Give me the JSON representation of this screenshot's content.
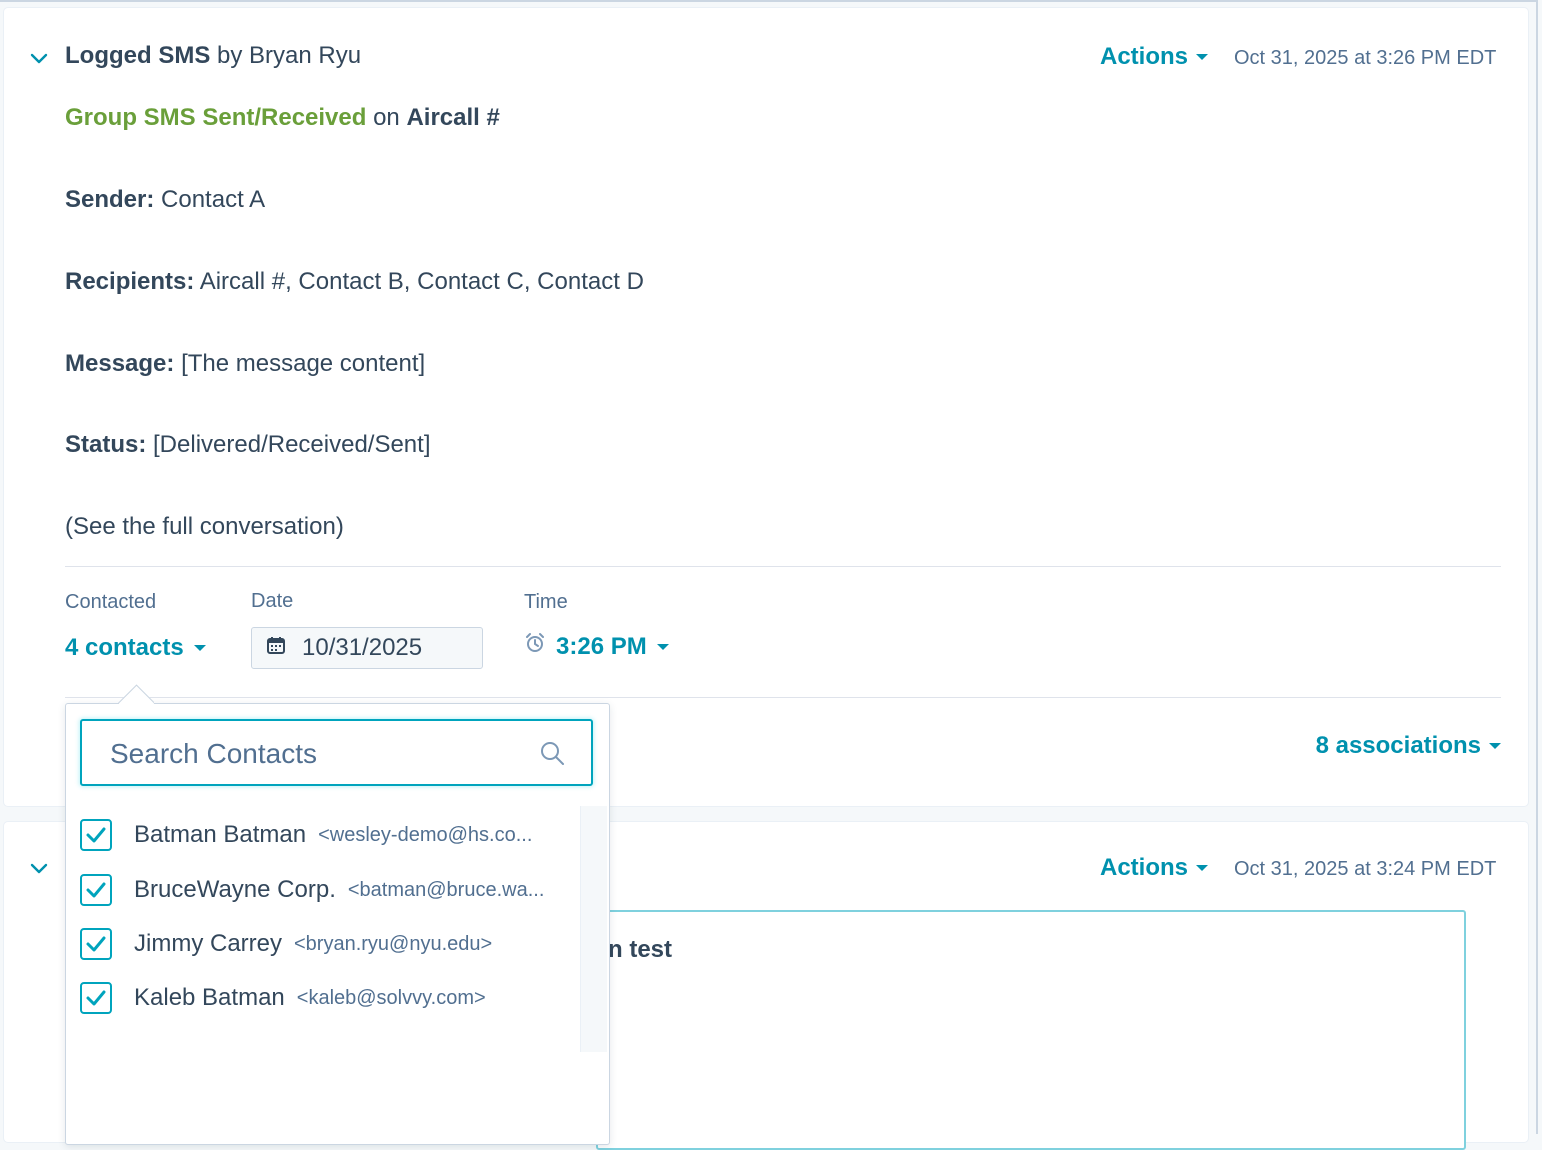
{
  "entry1": {
    "title_bold": "Logged SMS",
    "title_rest": "by Bryan Ryu",
    "actions_label": "Actions",
    "timestamp": "Oct 31, 2025 at 3:26 PM EDT",
    "activity_type": "Group SMS Sent/Received",
    "on_text": "on",
    "line_name": "Aircall #",
    "sender_label": "Sender:",
    "sender_value": "Contact A",
    "recipients_label": "Recipients:",
    "recipients_value": "Aircall #, Contact B, Contact C, Contact D",
    "message_label": "Message:",
    "message_value": "[The message content]",
    "status_label": "Status:",
    "status_value": "[Delivered/Received/Sent]",
    "conversation_link": "(See the full conversation)",
    "contacted_label": "Contacted",
    "contacted_value": "4 contacts",
    "date_label": "Date",
    "date_value": "10/31/2025",
    "time_label": "Time",
    "time_value": "3:26 PM",
    "associations": "8 associations"
  },
  "entry2": {
    "actions_label": "Actions",
    "timestamp": "Oct 31, 2025 at 3:24 PM EDT",
    "comment_fragment": "n test"
  },
  "popover": {
    "search_placeholder": "Search Contacts",
    "contacts": [
      {
        "name": "Batman Batman",
        "email": "<wesley-demo@hs.co...",
        "checked": true
      },
      {
        "name": "BruceWayne Corp.",
        "email": "<batman@bruce.wa...",
        "checked": true
      },
      {
        "name": "Jimmy Carrey",
        "email": "<bryan.ryu@nyu.edu>",
        "checked": true
      },
      {
        "name": "Kaleb Batman",
        "email": "<kaleb@solvvy.com>",
        "checked": true
      }
    ]
  },
  "colors": {
    "accent": "#0091ae",
    "activity_green": "#6a9f3a",
    "text": "#33475b",
    "checkbox": "#00a4bd"
  },
  "icons": [
    "chevron-down-icon",
    "caret-down-icon",
    "calendar-icon",
    "alarm-clock-icon",
    "search-icon",
    "checkmark-icon"
  ]
}
